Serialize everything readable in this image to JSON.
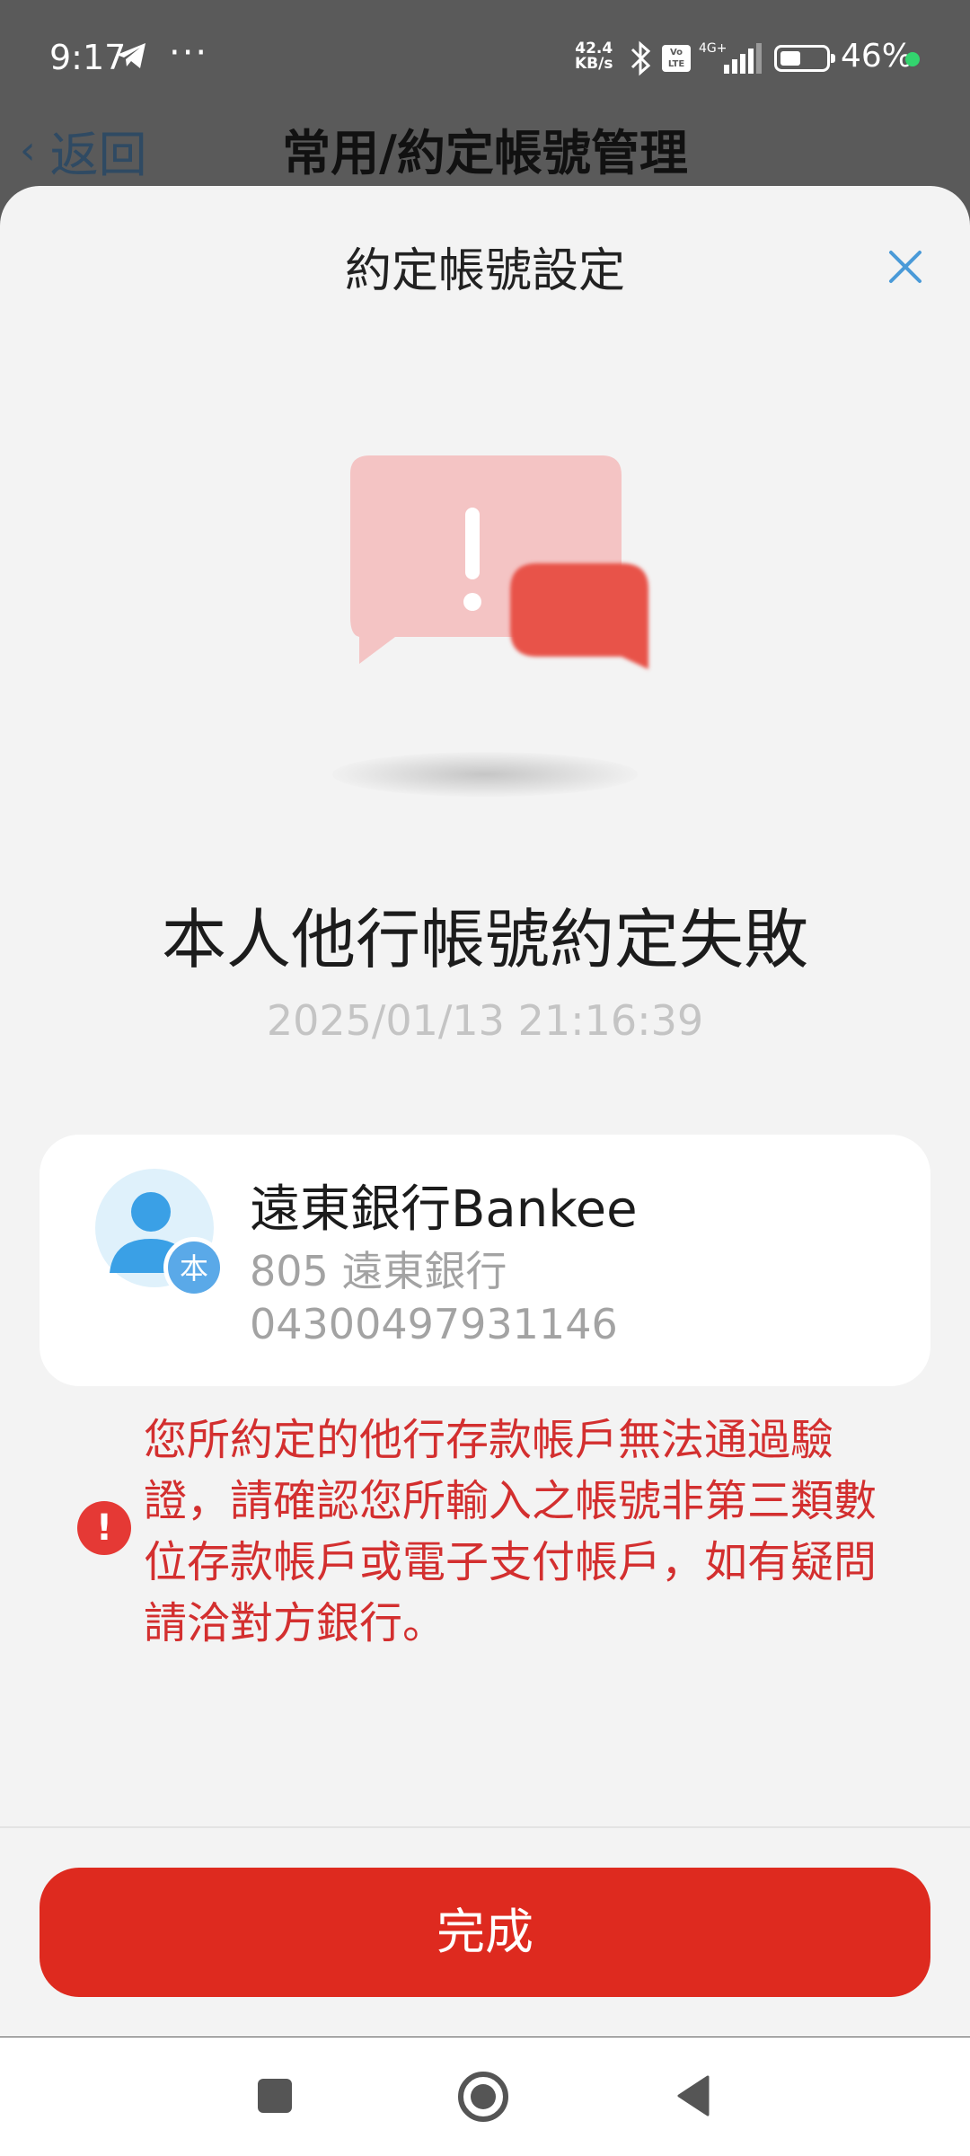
{
  "status_bar": {
    "time": "9:17",
    "dots": "···",
    "net_speed_value": "42.4",
    "net_speed_unit": "KB/s",
    "volte": "Vo LTE",
    "network": "4G+",
    "battery_percent": "46%",
    "battery_level": 0.46
  },
  "background_page": {
    "back_label": "返回",
    "title": "常用/約定帳號管理"
  },
  "sheet": {
    "title": "約定帳號設定",
    "result_title": "本人他行帳號約定失敗",
    "timestamp": "2025/01/13 21:16:39",
    "account": {
      "avatar_badge": "本",
      "name": "遠東銀行Bankee",
      "bank": "805 遠東銀行",
      "number": "04300497931146"
    },
    "error_message": "您所約定的他行存款帳戶無法通過驗證，請確認您所輸入之帳號非第三類數位存款帳戶或電子支付帳戶，如有疑問請洽對方銀行。",
    "done_label": "完成"
  },
  "colors": {
    "primary_red": "#de2a1f",
    "error_red": "#d32f2f",
    "close_blue": "#4a9ad8"
  }
}
